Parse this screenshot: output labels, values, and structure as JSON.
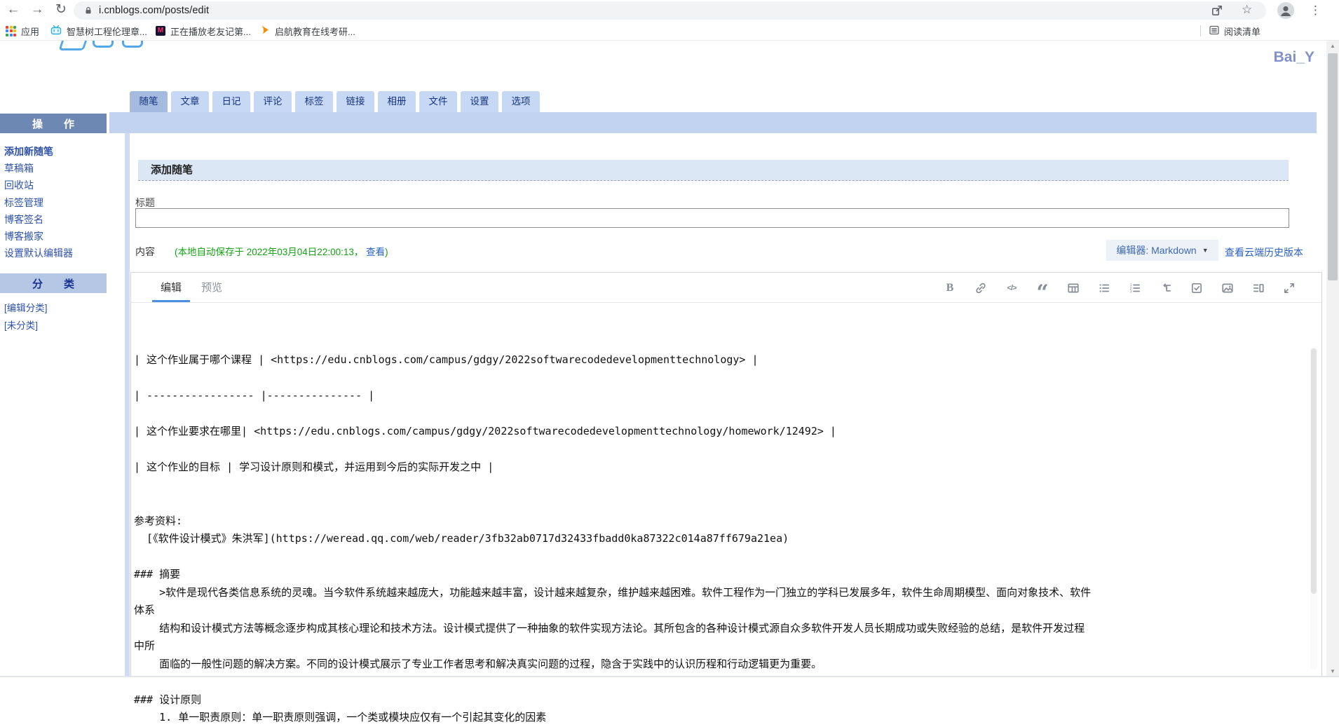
{
  "colors": {
    "band_blue": "#c2d3f0",
    "tab_active": "#a4bade",
    "sidebar_header_dark": "#6e88b4",
    "sidebar_header_light": "#b6c7e6",
    "link_blue": "#2d52a8",
    "autosave_green": "#14a314",
    "username_blue": "#8191c8"
  },
  "browser": {
    "url": "i.cnblogs.com/posts/edit",
    "bookmarks": [
      {
        "icon": "apps-grid-icon",
        "label": "应用"
      },
      {
        "icon": "tv-icon",
        "label": "智慧树工程伦理章..."
      },
      {
        "icon": "m-icon",
        "label": "正在播放老友记第..."
      },
      {
        "icon": "play-icon",
        "label": "启航教育在线考研..."
      }
    ],
    "reading_list_label": "阅读清单"
  },
  "page": {
    "username": "Bai_Y",
    "tabs": [
      "随笔",
      "文章",
      "日记",
      "评论",
      "标签",
      "链接",
      "相册",
      "文件",
      "设置",
      "选项"
    ],
    "active_tab": "随笔",
    "sidebar": {
      "ops_header": "操 作",
      "ops": [
        "添加新随笔",
        "草稿箱",
        "回收站",
        "标签管理",
        "博客签名",
        "博客搬家",
        "设置默认编辑器"
      ],
      "cat_header": "分 类",
      "cats": [
        "[编辑分类]",
        "[未分类]"
      ]
    },
    "form": {
      "section_title": "添加随笔",
      "title_label": "标题",
      "title_value": "",
      "content_label": "内容",
      "autosave_prefix": "(本地自动保存于 2022年03月04日22:00:13，",
      "autosave_link": "查看",
      "autosave_suffix": ")",
      "editor_select_label": "编辑器: Markdown",
      "history_link": "查看云端历史版本"
    },
    "editor": {
      "tab_edit": "编辑",
      "tab_preview": "预览",
      "toolbar_icons": [
        "bold",
        "link",
        "code",
        "quote",
        "table",
        "unordered-list",
        "ordered-list",
        "outline",
        "task-list",
        "image",
        "side-by-side",
        "fullscreen"
      ],
      "content_lines": [
        "| 这个作业属于哪个课程 | <https://edu.cnblogs.com/campus/gdgy/2022softwarecodedevelopmenttechnology> |",
        "",
        "| ----------------- |--------------- |",
        "",
        "| 这个作业要求在哪里| <https://edu.cnblogs.com/campus/gdgy/2022softwarecodedevelopmenttechnology/homework/12492> |",
        "",
        "| 这个作业的目标 | 学习设计原则和模式，并运用到今后的实际开发之中 |",
        "",
        "",
        "参考资料:",
        "  [《软件设计模式》朱洪军](https://weread.qq.com/web/reader/3fb32ab0717d32433fbadd0ka87322c014a87ff679a21ea)",
        "",
        "### 摘要",
        "    >软件是现代各类信息系统的灵魂。当今软件系统越来越庞大，功能越来越丰富，设计越来越复杂，维护越来越困难。软件工程作为一门独立的学科已发展多年，软件生命周期模型、面向对象技术、软件",
        "体系",
        "    结构和设计模式方法等概念逐步构成其核心理论和技术方法。设计模式提供了一种抽象的软件实现方法论。其所包含的各种设计模式源自众多软件开发人员长期成功或失败经验的总结，是软件开发过程",
        "中所",
        "    面临的一般性问题的解决方案。不同的设计模式展示了专业工作者思考和解决真实问题的过程，隐含于实践中的认识历程和行动逻辑更为重要。",
        "",
        "### 设计原则",
        "    1. 单一职责原则：单一职责原则强调，一个类或模块应仅有一个引起其变化的因素"
      ]
    }
  }
}
